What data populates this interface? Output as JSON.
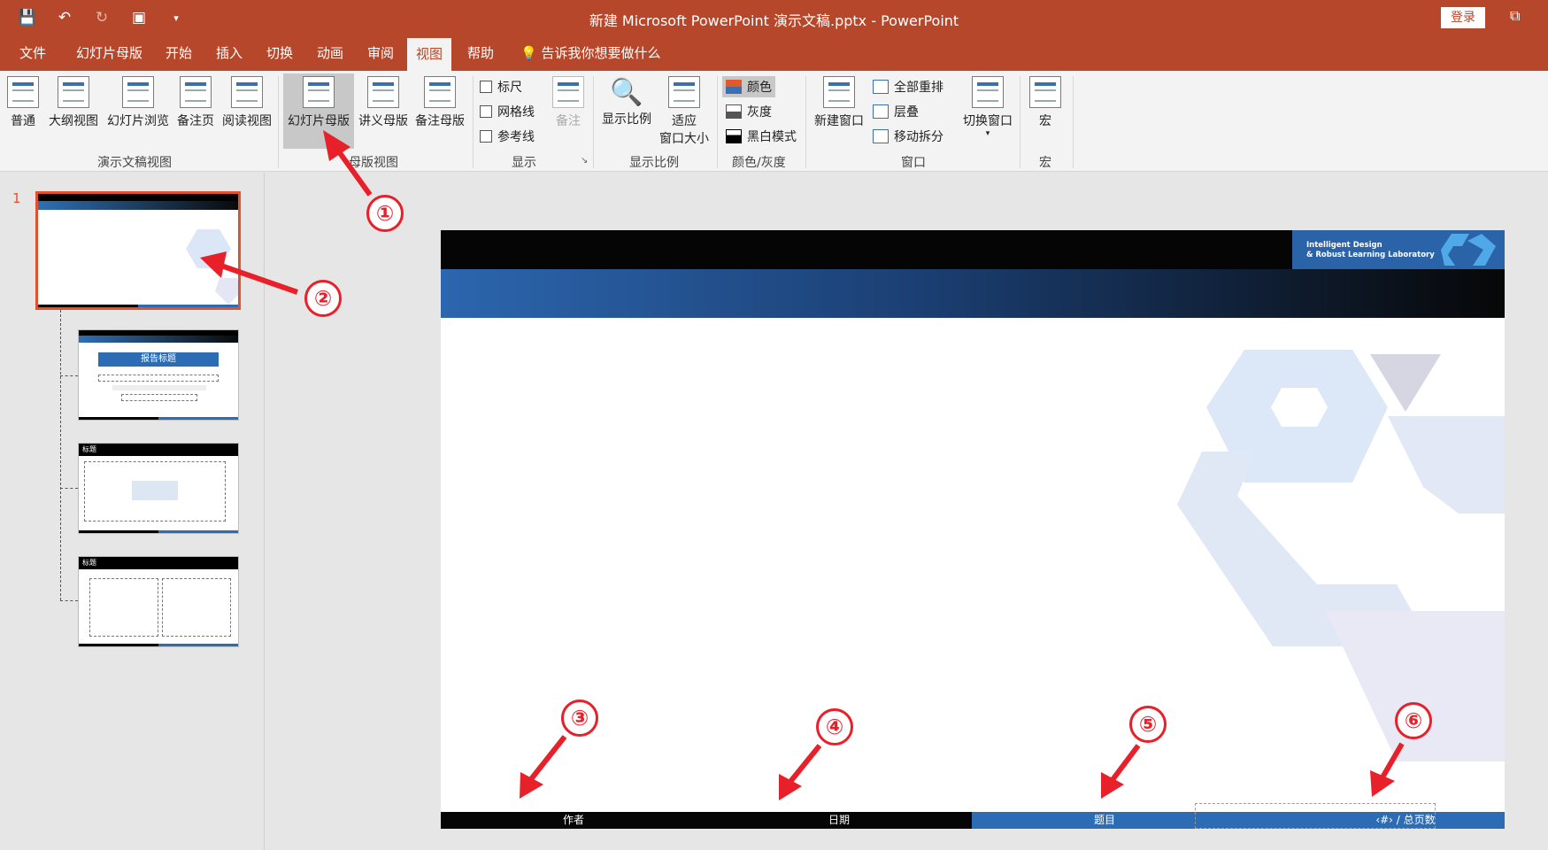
{
  "window": {
    "title": "新建 Microsoft PowerPoint 演示文稿.pptx  -  PowerPoint",
    "login": "登录"
  },
  "tabs": [
    "文件",
    "幻灯片母版",
    "开始",
    "插入",
    "切换",
    "动画",
    "审阅",
    "视图",
    "帮助"
  ],
  "tell_me": "告诉我你想要做什么",
  "ribbon": {
    "presentation_views": {
      "label": "演示文稿视图",
      "buttons": [
        "普通",
        "大纲视图",
        "幻灯片浏览",
        "备注页",
        "阅读视图"
      ]
    },
    "master_views": {
      "label": "母版视图",
      "buttons": [
        "幻灯片母版",
        "讲义母版",
        "备注母版"
      ]
    },
    "show": {
      "label": "显示",
      "items": [
        "标尺",
        "网格线",
        "参考线"
      ],
      "notes": "备注"
    },
    "zoom": {
      "label": "显示比例",
      "zoom": "显示比例",
      "fit_line1": "适应",
      "fit_line2": "窗口大小"
    },
    "color": {
      "label": "颜色/灰度",
      "items": [
        "颜色",
        "灰度",
        "黑白模式"
      ]
    },
    "window": {
      "label": "窗口",
      "new_window": "新建窗口",
      "arrange_all": "全部重排",
      "cascade": "层叠",
      "move_split": "移动拆分",
      "switch_window": "切换窗口"
    },
    "macros": {
      "label": "宏",
      "button": "宏"
    }
  },
  "thumbnails": {
    "slide_number": "1",
    "layout1_title": "报告标题",
    "layout2_title": "标题",
    "layout3_title": "标题"
  },
  "slide": {
    "logo_line1": "Intelligent Design",
    "logo_line2": "& Robust Learning Laboratory",
    "footer_author": "作者",
    "footer_date": "日期",
    "footer_topic": "题目",
    "footer_page": "‹#› / 总页数"
  },
  "annotations": [
    "①",
    "②",
    "③",
    "④",
    "⑤",
    "⑥"
  ],
  "colors": {
    "accent": "#b7472a",
    "annotation": "#e8202a",
    "slide_blue": "#2b6cb5"
  }
}
